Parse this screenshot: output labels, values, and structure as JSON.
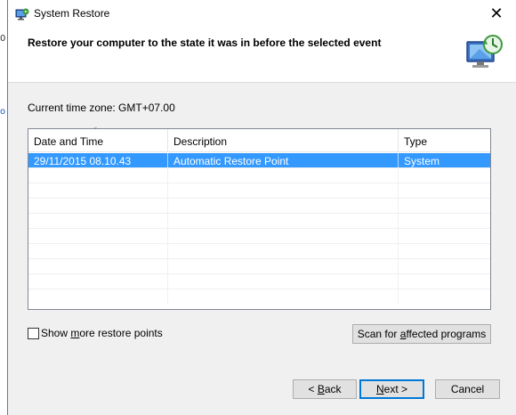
{
  "window": {
    "title": "System Restore",
    "close_glyph": "✕"
  },
  "header": {
    "title": "Restore your computer to the state it was in before the selected event",
    "icon": "system-restore-monitor-icon"
  },
  "timezone_label": "Current time zone: GMT+07.00",
  "table": {
    "columns": [
      "Date and Time",
      "Description",
      "Type"
    ],
    "sort_indicator": "˅",
    "rows": [
      [
        "29/11/2015 08.10.43",
        "Automatic Restore Point",
        "System"
      ]
    ],
    "selected_row": 0,
    "selection_color": "#3399ff"
  },
  "checkbox": {
    "label_prefix": "Show ",
    "label_underlined": "m",
    "label_suffix": "ore restore points",
    "checked": false
  },
  "buttons": {
    "scan_prefix": "Scan for ",
    "scan_underlined": "a",
    "scan_suffix": "ffected programs",
    "back_prefix": "< ",
    "back_underlined": "B",
    "back_suffix": "ack",
    "next_underlined": "N",
    "next_suffix": "ext >",
    "cancel": "Cancel"
  },
  "accent_color": "#0078d7",
  "background_window": {
    "glyph_top": "0",
    "glyph_bottom": "o"
  }
}
